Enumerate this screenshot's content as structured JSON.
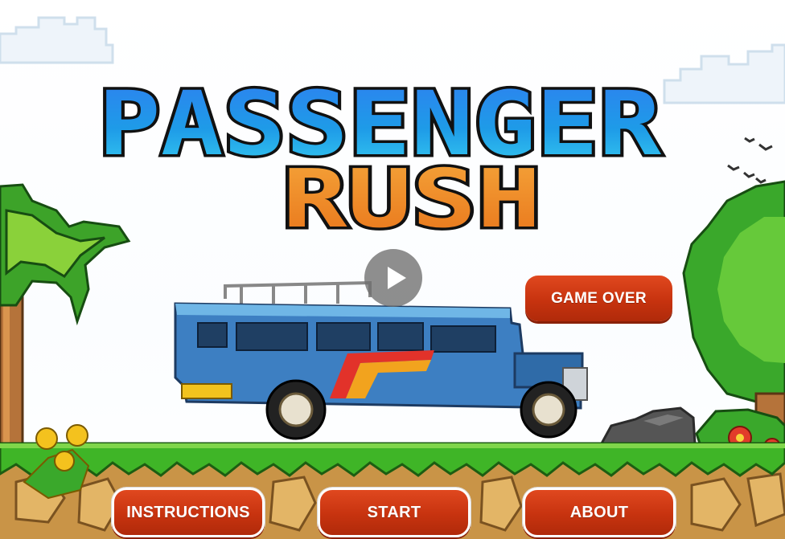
{
  "title": {
    "line1": "PASSENGER",
    "line2": "RUSH"
  },
  "buttons": {
    "game_over": "GAME OVER",
    "instructions": "INSTRUCTIONS",
    "start": "START",
    "about": "ABOUT"
  },
  "icons": {
    "play": "play-icon"
  },
  "colors": {
    "title_line1": "#1a8ae6",
    "title_line2": "#f08a1e",
    "button": "#c7330f",
    "grass": "#3fb527",
    "dirt": "#c99447",
    "jeepney_body": "#3d7fc2"
  }
}
